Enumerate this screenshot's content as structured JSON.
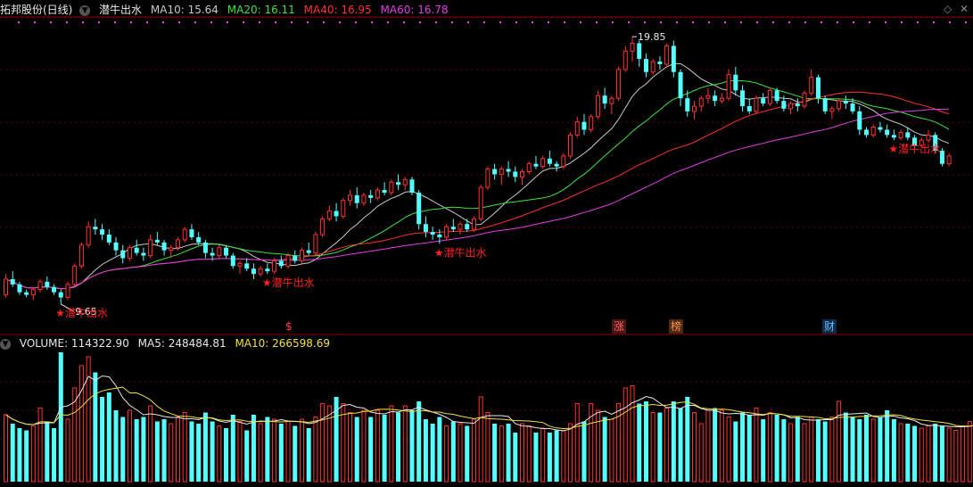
{
  "header": {
    "stock_name": "拓邦股份(日线)",
    "formula_name": "潜牛出水",
    "ma": [
      {
        "label": "MA10: 15.64",
        "color": "#c8c8c8"
      },
      {
        "label": "MA20: 16.11",
        "color": "#3de23d"
      },
      {
        "label": "MA40: 16.95",
        "color": "#ff3030"
      },
      {
        "label": "MA60: 16.78",
        "color": "#e040e0"
      }
    ]
  },
  "volume_header": {
    "volume": "VOLUME: 114322.90",
    "ma5": "MA5: 248484.81",
    "ma10": "MA10: 266598.69"
  },
  "signal_label": "★潜牛出水",
  "markers": [
    {
      "text": "$",
      "color": "#ff4040",
      "bg": ""
    },
    {
      "text": "涨",
      "color": "#ff6060",
      "bg": "#4a1515"
    },
    {
      "text": "榜",
      "color": "#ff9050",
      "bg": "#4a2a10"
    },
    {
      "text": "财",
      "color": "#60c0ff",
      "bg": "#102a4a"
    }
  ],
  "chart_data": [
    {
      "type": "candlestick",
      "annotations": {
        "high": "19.85",
        "low": "9.65"
      },
      "signals_at_candle": [
        8,
        38,
        63,
        129,
        150
      ],
      "candles": [
        [
          10.0,
          10.8,
          9.9,
          10.6
        ],
        [
          10.6,
          10.9,
          10.3,
          10.4
        ],
        [
          10.4,
          10.5,
          10.0,
          10.1
        ],
        [
          10.1,
          10.2,
          9.9,
          10.0
        ],
        [
          10.0,
          10.3,
          9.8,
          10.2
        ],
        [
          10.2,
          10.6,
          10.1,
          10.5
        ],
        [
          10.5,
          10.7,
          10.2,
          10.3
        ],
        [
          10.3,
          10.4,
          10.0,
          10.1
        ],
        [
          10.1,
          10.2,
          9.65,
          9.9
        ],
        [
          9.9,
          10.5,
          9.8,
          10.4
        ],
        [
          10.4,
          11.2,
          10.3,
          11.1
        ],
        [
          11.1,
          12.0,
          11.0,
          11.9
        ],
        [
          11.9,
          12.8,
          11.8,
          12.6
        ],
        [
          12.6,
          12.9,
          12.3,
          12.5
        ],
        [
          12.5,
          12.7,
          12.1,
          12.3
        ],
        [
          12.3,
          12.5,
          11.9,
          12.0
        ],
        [
          12.0,
          12.2,
          11.5,
          11.7
        ],
        [
          11.7,
          11.9,
          11.2,
          11.4
        ],
        [
          11.4,
          11.9,
          11.3,
          11.8
        ],
        [
          11.8,
          12.1,
          11.5,
          11.6
        ],
        [
          11.6,
          11.8,
          11.3,
          11.5
        ],
        [
          11.5,
          12.3,
          11.4,
          12.1
        ],
        [
          12.1,
          12.4,
          11.9,
          12.0
        ],
        [
          12.0,
          12.1,
          11.5,
          11.7
        ],
        [
          11.7,
          11.9,
          11.4,
          11.8
        ],
        [
          11.8,
          12.2,
          11.7,
          12.1
        ],
        [
          12.1,
          12.6,
          12.0,
          12.5
        ],
        [
          12.5,
          12.7,
          12.1,
          12.2
        ],
        [
          12.2,
          12.4,
          11.9,
          12.0
        ],
        [
          12.0,
          12.1,
          11.4,
          11.6
        ],
        [
          11.6,
          11.8,
          11.3,
          11.5
        ],
        [
          11.5,
          11.9,
          11.4,
          11.8
        ],
        [
          11.8,
          11.9,
          11.4,
          11.5
        ],
        [
          11.5,
          11.6,
          11.0,
          11.1
        ],
        [
          11.1,
          11.3,
          10.8,
          11.2
        ],
        [
          11.2,
          11.4,
          10.9,
          11.0
        ],
        [
          11.0,
          11.2,
          10.6,
          10.8
        ],
        [
          10.8,
          11.1,
          10.7,
          11.0
        ],
        [
          11.0,
          11.2,
          10.8,
          10.9
        ],
        [
          10.9,
          11.4,
          10.8,
          11.3
        ],
        [
          11.3,
          11.5,
          11.0,
          11.1
        ],
        [
          11.1,
          11.6,
          11.0,
          11.5
        ],
        [
          11.5,
          11.7,
          11.2,
          11.3
        ],
        [
          11.3,
          11.8,
          11.2,
          11.7
        ],
        [
          11.7,
          12.0,
          11.5,
          11.6
        ],
        [
          11.6,
          12.4,
          11.5,
          12.3
        ],
        [
          12.3,
          13.0,
          12.2,
          12.9
        ],
        [
          12.9,
          13.4,
          12.8,
          13.2
        ],
        [
          13.2,
          13.5,
          12.8,
          13.0
        ],
        [
          13.0,
          13.7,
          12.9,
          13.6
        ],
        [
          13.6,
          14.0,
          13.4,
          13.8
        ],
        [
          13.8,
          14.1,
          13.3,
          13.5
        ],
        [
          13.5,
          13.9,
          13.4,
          13.8
        ],
        [
          13.8,
          14.0,
          13.5,
          13.7
        ],
        [
          13.7,
          14.1,
          13.6,
          14.0
        ],
        [
          14.0,
          14.3,
          13.8,
          13.9
        ],
        [
          13.9,
          14.4,
          13.8,
          14.3
        ],
        [
          14.3,
          14.6,
          14.0,
          14.2
        ],
        [
          14.2,
          14.5,
          14.0,
          14.4
        ],
        [
          14.4,
          14.5,
          13.8,
          13.9
        ],
        [
          13.9,
          14.0,
          12.5,
          12.7
        ],
        [
          12.7,
          13.0,
          12.2,
          12.4
        ],
        [
          12.4,
          12.6,
          12.1,
          12.3
        ],
        [
          12.3,
          12.5,
          11.95,
          12.2
        ],
        [
          12.2,
          12.7,
          12.1,
          12.6
        ],
        [
          12.6,
          12.9,
          12.4,
          12.5
        ],
        [
          12.5,
          12.8,
          12.3,
          12.7
        ],
        [
          12.7,
          12.9,
          12.4,
          12.5
        ],
        [
          12.5,
          13.0,
          12.4,
          12.9
        ],
        [
          12.9,
          14.2,
          12.8,
          14.1
        ],
        [
          14.1,
          14.9,
          14.0,
          14.8
        ],
        [
          14.8,
          15.0,
          14.4,
          14.6
        ],
        [
          14.6,
          14.9,
          14.2,
          14.8
        ],
        [
          14.8,
          15.1,
          14.5,
          14.7
        ],
        [
          14.7,
          14.9,
          14.3,
          14.5
        ],
        [
          14.5,
          14.8,
          14.2,
          14.7
        ],
        [
          14.7,
          15.1,
          14.6,
          15.0
        ],
        [
          15.0,
          15.3,
          14.8,
          14.9
        ],
        [
          14.9,
          15.3,
          14.8,
          15.2
        ],
        [
          15.2,
          15.5,
          14.9,
          15.0
        ],
        [
          15.0,
          15.1,
          14.7,
          14.9
        ],
        [
          14.9,
          15.4,
          14.8,
          15.3
        ],
        [
          15.3,
          16.2,
          15.2,
          16.1
        ],
        [
          16.1,
          16.8,
          16.0,
          16.6
        ],
        [
          16.6,
          16.9,
          16.1,
          16.3
        ],
        [
          16.3,
          16.9,
          16.2,
          16.8
        ],
        [
          16.8,
          17.8,
          16.7,
          17.6
        ],
        [
          17.6,
          17.9,
          17.1,
          17.3
        ],
        [
          17.3,
          17.6,
          16.9,
          17.5
        ],
        [
          17.5,
          18.7,
          17.4,
          18.6
        ],
        [
          18.6,
          19.5,
          18.5,
          19.3
        ],
        [
          19.3,
          19.85,
          18.9,
          19.6
        ],
        [
          19.6,
          19.7,
          18.7,
          19.0
        ],
        [
          19.0,
          19.2,
          18.3,
          18.5
        ],
        [
          18.5,
          19.0,
          18.4,
          18.9
        ],
        [
          18.9,
          19.1,
          18.6,
          18.8
        ],
        [
          18.8,
          19.6,
          18.7,
          19.5
        ],
        [
          19.5,
          19.7,
          18.3,
          18.5
        ],
        [
          18.5,
          18.6,
          17.2,
          17.5
        ],
        [
          17.5,
          17.8,
          16.8,
          17.0
        ],
        [
          17.0,
          17.4,
          16.7,
          17.2
        ],
        [
          17.2,
          17.6,
          17.0,
          17.5
        ],
        [
          17.5,
          17.9,
          17.3,
          17.6
        ],
        [
          17.6,
          17.8,
          17.2,
          17.4
        ],
        [
          17.4,
          17.7,
          17.3,
          17.5
        ],
        [
          17.5,
          18.6,
          17.4,
          18.4
        ],
        [
          18.4,
          18.7,
          17.6,
          17.8
        ],
        [
          17.8,
          18.0,
          17.0,
          17.2
        ],
        [
          17.2,
          17.5,
          16.9,
          17.0
        ],
        [
          17.0,
          17.6,
          16.9,
          17.5
        ],
        [
          17.5,
          17.7,
          17.2,
          17.3
        ],
        [
          17.3,
          17.9,
          17.2,
          17.8
        ],
        [
          17.8,
          17.9,
          17.3,
          17.4
        ],
        [
          17.4,
          17.6,
          17.0,
          17.1
        ],
        [
          17.1,
          17.4,
          16.9,
          17.3
        ],
        [
          17.3,
          17.5,
          17.0,
          17.2
        ],
        [
          17.2,
          17.8,
          17.1,
          17.7
        ],
        [
          17.7,
          18.6,
          17.6,
          18.3
        ],
        [
          18.3,
          18.4,
          17.3,
          17.5
        ],
        [
          17.5,
          17.6,
          16.9,
          17.0
        ],
        [
          17.0,
          17.2,
          16.7,
          17.1
        ],
        [
          17.1,
          17.5,
          17.0,
          17.4
        ],
        [
          17.4,
          17.6,
          17.1,
          17.3
        ],
        [
          17.3,
          17.5,
          16.9,
          17.0
        ],
        [
          17.0,
          17.2,
          16.1,
          16.3
        ],
        [
          16.3,
          16.4,
          16.0,
          16.1
        ],
        [
          16.1,
          16.5,
          16.0,
          16.4
        ],
        [
          16.4,
          16.6,
          16.2,
          16.3
        ],
        [
          16.3,
          16.5,
          16.0,
          16.1
        ],
        [
          16.1,
          16.3,
          15.9,
          16.0
        ],
        [
          16.0,
          16.3,
          15.9,
          16.2
        ],
        [
          16.2,
          16.4,
          15.9,
          16.0
        ],
        [
          16.0,
          16.1,
          15.6,
          15.7
        ],
        [
          15.7,
          16.0,
          15.6,
          15.9
        ],
        [
          15.9,
          16.3,
          15.8,
          16.1
        ],
        [
          16.1,
          16.2,
          15.4,
          15.5
        ],
        [
          15.5,
          15.6,
          14.9,
          15.0
        ],
        [
          15.0,
          15.4,
          14.9,
          15.3
        ]
      ]
    },
    {
      "type": "bar",
      "volumes": [
        3.0,
        2.6,
        2.4,
        2.3,
        2.5,
        3.3,
        2.7,
        2.4,
        5.8,
        2.8,
        4.2,
        5.2,
        5.6,
        4.9,
        3.8,
        4.0,
        3.2,
        2.9,
        3.2,
        2.8,
        2.9,
        3.4,
        2.7,
        2.8,
        2.6,
        2.9,
        3.1,
        2.7,
        2.6,
        3.1,
        2.7,
        2.5,
        2.4,
        3.0,
        2.7,
        2.3,
        3.0,
        2.6,
        2.9,
        2.8,
        2.6,
        2.7,
        2.5,
        2.8,
        2.4,
        2.9,
        3.5,
        3.4,
        3.8,
        3.5,
        3.1,
        2.9,
        3.2,
        2.9,
        3.2,
        3.0,
        3.4,
        3.1,
        3.4,
        3.2,
        3.6,
        2.8,
        2.6,
        2.9,
        2.5,
        2.7,
        2.6,
        2.5,
        2.8,
        3.8,
        3.1,
        2.6,
        2.5,
        2.6,
        2.2,
        2.6,
        2.5,
        2.2,
        2.4,
        2.2,
        2.3,
        2.3,
        2.6,
        3.5,
        2.7,
        3.5,
        3.2,
        2.9,
        2.8,
        3.5,
        4.2,
        4.3,
        3.5,
        3.6,
        3.1,
        3.1,
        3.3,
        3.6,
        3.3,
        3.8,
        3.1,
        2.6,
        3.2,
        3.3,
        3.2,
        2.9,
        2.7,
        3.1,
        3.0,
        3.3,
        2.8,
        3.1,
        3.0,
        2.8,
        2.6,
        2.9,
        2.6,
        2.9,
        2.8,
        2.7,
        2.9,
        3.6,
        3.1,
        2.9,
        2.8,
        3.0,
        2.8,
        2.9,
        3.2,
        2.8,
        2.6,
        2.6,
        2.5,
        2.4,
        2.5,
        2.6,
        2.5,
        2.4,
        2.3,
        2.5,
        2.7,
        2.8,
        3.6
      ]
    }
  ]
}
